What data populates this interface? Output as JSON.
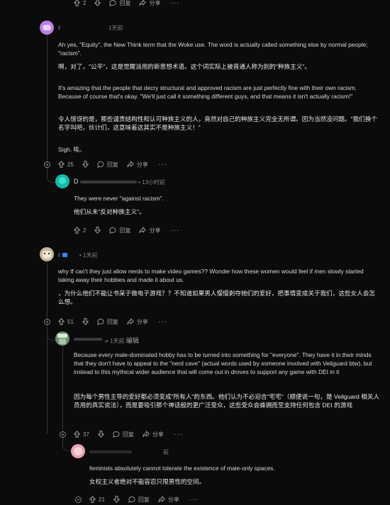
{
  "top_bar": {
    "votes": "2",
    "reply": "回复",
    "share": "分享"
  },
  "comments": [
    {
      "username": "",
      "time": "1天前",
      "paragraphs": [
        "Ah yes, \"Equity\", the New Think term that the Woke use. The word is actually called something else by normal people; \"racism\".",
        "啊，对了，\"公平\"，这是觉醒派用的新思想术语。这个词实际上被普通人称为别的\"种族主义\"。",
        "It's amazing that the people that decry structural and approved racism are just perfectly fine with their own racism. Because of course that's okay. \"We'll just call it something different guys, and that means it isn't actually racism!\"",
        "令人惊讶的是，那些谴责结构性和认可种族主义的人，竟然对自己的种族主义完全无所谓。因为当然没问题。\"我们换个名字叫吧，伙计们，这意味着这其实不是种族主义！\"",
        "Sigh.  唉。"
      ],
      "votes": "25",
      "reply": "回复",
      "share": "分享"
    },
    {
      "username": "D",
      "time": "13小时前",
      "paragraphs": [
        "They were never \"against racism\".",
        "他们从未\"反对种族主义\"。"
      ],
      "votes": "2",
      "reply": "回复",
      "share": "分享"
    },
    {
      "username": "",
      "time": "1天前",
      "paragraphs": [
        "why tf can't they just allow nerds to make video games?? Wonder how these women would feel if men slowly started taking away their hobbies and made it about us.",
        "，为什么他们不能让书呆子做电子游戏？？不知道如果男人慢慢剥夺她们的爱好，把事情变成关于我们，这些女人会怎么想。"
      ],
      "votes": "51",
      "reply": "回复",
      "share": "分享"
    },
    {
      "username": "",
      "time": "1天前",
      "edited": "编辑",
      "paragraphs": [
        "Because every male-dominated hobby has to be turned into something for \"everyone\". They have it in their minds that they don't have to appeal to the \"nerd cave\" (actual words used by someone involved with Veilguard btw), but instead to this mythical wider audience that will come out in droves to support any game with DEI in it",
        "因为每个男性主导的爱好都必须变成\"所有人\"的东西。他们认为不必迎合\"宅宅\"（顺便说一句，是 Veilguard 相关人员用的真实说法），而是要吸引那个神话般的更广泛受众，这些受众会蜂拥而至支持任何包含 DEI 的游戏"
      ],
      "votes": "37",
      "reply": "回复",
      "share": "分享"
    },
    {
      "username": "",
      "time": "前",
      "paragraphs": [
        "feminists absolutely cannot tolerate the existence of male-only spaces.",
        "女权主义者绝对不能容忍只限男性的空间。"
      ],
      "votes": "21",
      "reply": "回复",
      "share": "分享"
    }
  ],
  "colors": {
    "background": "#0b0b0b",
    "text": "#d7dadc",
    "meta": "#818384",
    "avatar_1": "#b97fe0",
    "avatar_2": "#14b8a6",
    "avatar_3": "#c9b79c",
    "avatar_4": "#6b8f6b",
    "avatar_5": "#e9a3b0"
  },
  "icons": [
    "upvote-icon",
    "downvote-icon",
    "reply-icon",
    "share-icon",
    "more-icon",
    "collapse-icon"
  ]
}
